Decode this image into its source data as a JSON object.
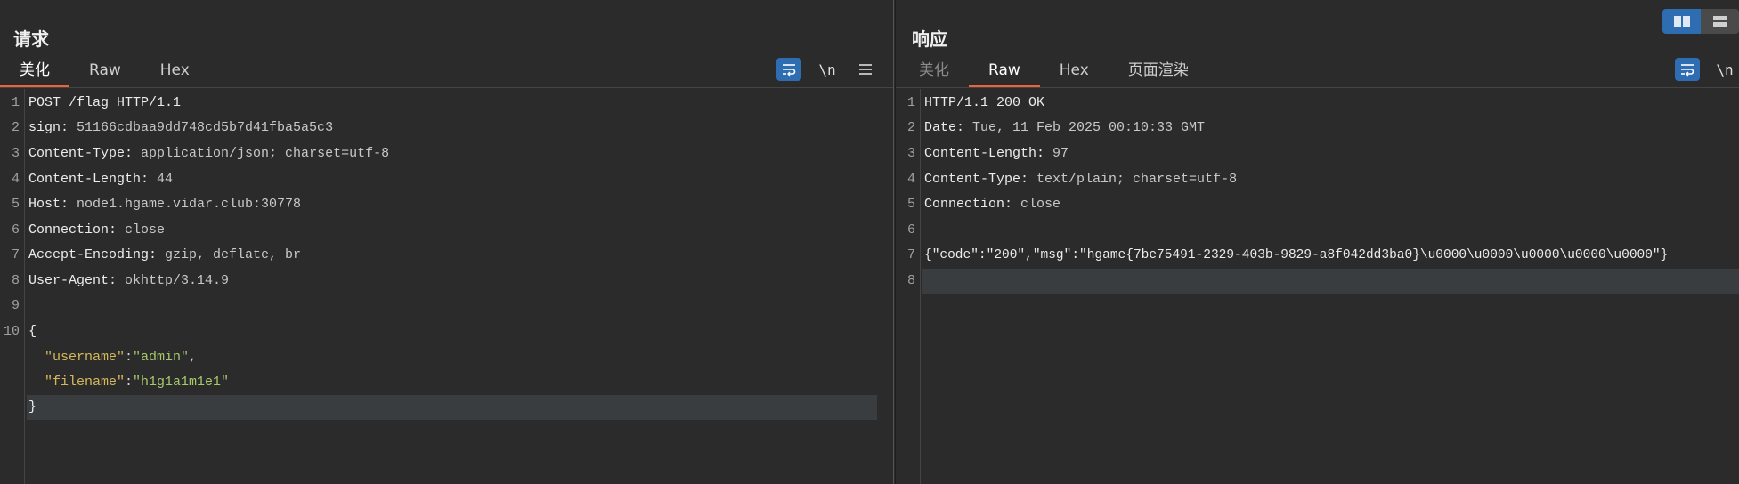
{
  "request": {
    "title": "请求",
    "tabs": [
      "美化",
      "Raw",
      "Hex"
    ],
    "active_tab": 0,
    "tools": {
      "newline_label": "\\n"
    },
    "lines": [
      {
        "num": "1",
        "key": "POST /flag HTTP/1.1",
        "value": ""
      },
      {
        "num": "2",
        "key": "sign:",
        "value": " 51166cdbaa9dd748cd5b7d41fba5a5c3"
      },
      {
        "num": "3",
        "key": "Content-Type:",
        "value": " application/json; charset=utf-8"
      },
      {
        "num": "4",
        "key": "Content-Length:",
        "value": " 44"
      },
      {
        "num": "5",
        "key": "Host:",
        "value": " node1.hgame.vidar.club:30778"
      },
      {
        "num": "6",
        "key": "Connection:",
        "value": " close"
      },
      {
        "num": "7",
        "key": "Accept-Encoding:",
        "value": " gzip, deflate, br"
      },
      {
        "num": "8",
        "key": "User-Agent:",
        "value": " okhttp/3.14.9"
      },
      {
        "num": "9",
        "key": "",
        "value": ""
      },
      {
        "num": "10",
        "key": "{",
        "value": ""
      }
    ],
    "json_body": [
      {
        "key": "\"username\"",
        "sep": ":",
        "value": "\"admin\"",
        "trail": ","
      },
      {
        "key": "\"filename\"",
        "sep": ":",
        "value": "\"h1g1a1m1e1\"",
        "trail": ""
      }
    ],
    "closing": "}"
  },
  "response": {
    "title": "响应",
    "tabs": [
      "美化",
      "Raw",
      "Hex",
      "页面渲染"
    ],
    "active_tab": 1,
    "tools": {
      "newline_label": "\\n"
    },
    "lines": [
      {
        "num": "1",
        "key": "HTTP/1.1 200 OK",
        "value": ""
      },
      {
        "num": "2",
        "key": "Date:",
        "value": " Tue, 11 Feb 2025 00:10:33 GMT"
      },
      {
        "num": "3",
        "key": "Content-Length:",
        "value": " 97"
      },
      {
        "num": "4",
        "key": "Content-Type:",
        "value": " text/plain; charset=utf-8"
      },
      {
        "num": "5",
        "key": "Connection:",
        "value": " close"
      },
      {
        "num": "6",
        "key": "",
        "value": ""
      },
      {
        "num": "7",
        "key": "{\"code\":\"200\",\"msg\":\"hgame{7be75491-2329-403b-9829-a8f042dd3ba0}\\u0000\\u0000\\u0000\\u0000\\u0000\"}",
        "value": ""
      },
      {
        "num": "8",
        "key": "",
        "value": ""
      }
    ]
  },
  "icons": {
    "wrap": "word-wrap-icon",
    "menu": "hamburger-menu-icon",
    "layout_split": "split-view-icon",
    "layout_stacked": "stacked-view-icon"
  },
  "colors": {
    "accent_tab": "#e8643c",
    "button_blue": "#2f6db3",
    "background": "#2b2b2b"
  }
}
